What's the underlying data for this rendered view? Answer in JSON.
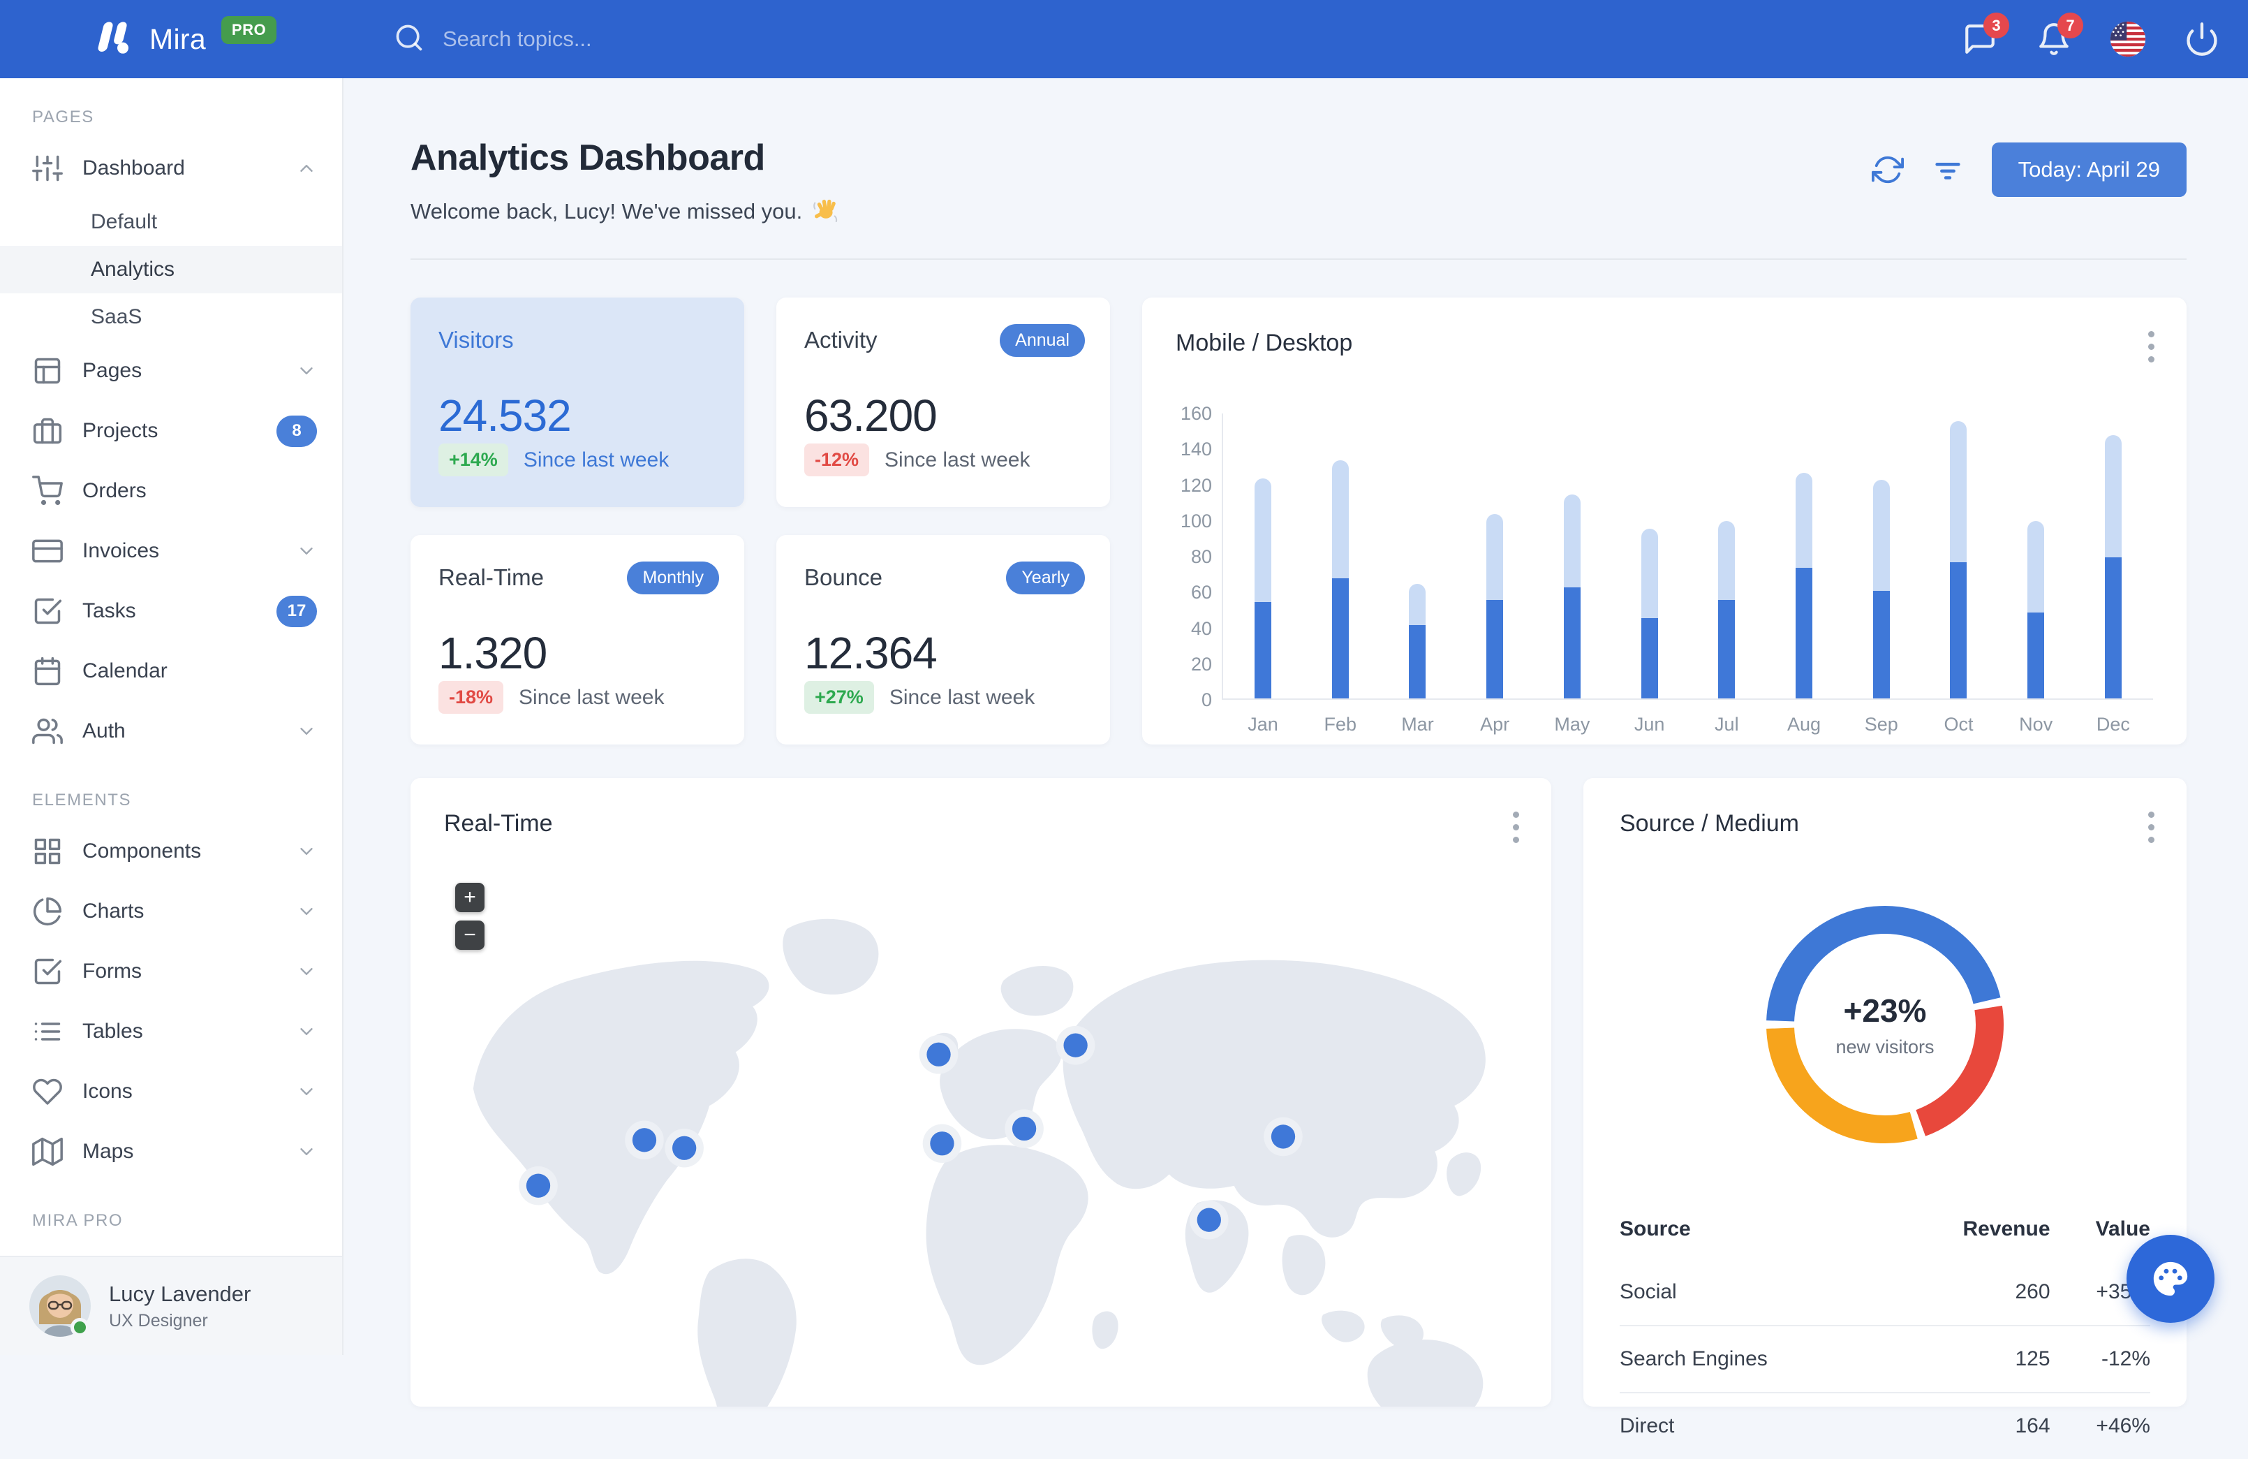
{
  "navbar": {
    "brand": "Mira",
    "brand_badge": "PRO",
    "search_placeholder": "Search topics...",
    "messages_badge": "3",
    "notifications_badge": "7"
  },
  "sidebar": {
    "sections": [
      {
        "label": "PAGES",
        "items": [
          {
            "icon": "sliders",
            "label": "Dashboard",
            "chevron": "up",
            "children": [
              {
                "label": "Default",
                "selected": false
              },
              {
                "label": "Analytics",
                "selected": true
              },
              {
                "label": "SaaS",
                "selected": false
              }
            ]
          },
          {
            "icon": "layout",
            "label": "Pages",
            "chevron": "down"
          },
          {
            "icon": "briefcase",
            "label": "Projects",
            "badge": "8"
          },
          {
            "icon": "shopping-cart",
            "label": "Orders"
          },
          {
            "icon": "credit-card",
            "label": "Invoices",
            "chevron": "down"
          },
          {
            "icon": "check-square",
            "label": "Tasks",
            "badge": "17"
          },
          {
            "icon": "calendar",
            "label": "Calendar"
          },
          {
            "icon": "users",
            "label": "Auth",
            "chevron": "down"
          }
        ]
      },
      {
        "label": "ELEMENTS",
        "items": [
          {
            "icon": "grid",
            "label": "Components",
            "chevron": "down"
          },
          {
            "icon": "pie-chart",
            "label": "Charts",
            "chevron": "down"
          },
          {
            "icon": "check-square",
            "label": "Forms",
            "chevron": "down"
          },
          {
            "icon": "list",
            "label": "Tables",
            "chevron": "down"
          },
          {
            "icon": "heart",
            "label": "Icons",
            "chevron": "down"
          },
          {
            "icon": "map",
            "label": "Maps",
            "chevron": "down"
          }
        ]
      },
      {
        "label": "MIRA PRO",
        "items": []
      }
    ],
    "user": {
      "name": "Lucy Lavender",
      "role": "UX Designer"
    }
  },
  "header": {
    "title": "Analytics Dashboard",
    "subtitle": "Welcome back, Lucy! We've missed you.",
    "subtitle_emoji": "👋",
    "date_button": "Today: April 29"
  },
  "stats": [
    {
      "title": "Visitors",
      "value": "24.532",
      "delta": "+14%",
      "delta_kind": "up",
      "caption": "Since last week",
      "variant": "primary"
    },
    {
      "title": "Activity",
      "value": "63.200",
      "delta": "-12%",
      "delta_kind": "down",
      "caption": "Since last week",
      "badge": "Annual"
    },
    {
      "title": "Real-Time",
      "value": "1.320",
      "delta": "-18%",
      "delta_kind": "down",
      "caption": "Since last week",
      "badge": "Monthly"
    },
    {
      "title": "Bounce",
      "value": "12.364",
      "delta": "+27%",
      "delta_kind": "up",
      "caption": "Since last week",
      "badge": "Yearly"
    }
  ],
  "chart_data": [
    {
      "type": "bar",
      "title": "Mobile / Desktop",
      "stacked": true,
      "categories": [
        "Jan",
        "Feb",
        "Mar",
        "Apr",
        "May",
        "Jun",
        "Jul",
        "Aug",
        "Sep",
        "Oct",
        "Nov",
        "Dec"
      ],
      "series": [
        {
          "name": "Mobile",
          "color": "#3F78D8",
          "values": [
            54,
            67,
            41,
            55,
            62,
            45,
            55,
            73,
            60,
            76,
            48,
            79
          ]
        },
        {
          "name": "Desktop",
          "color": "#C9DBF5",
          "values": [
            69,
            66,
            23,
            48,
            52,
            50,
            44,
            53,
            62,
            79,
            51,
            68
          ]
        }
      ],
      "totals": [
        123,
        133,
        64,
        103,
        114,
        95,
        99,
        126,
        122,
        155,
        99,
        147
      ],
      "xlabel": "",
      "ylabel": "",
      "ylim": [
        0,
        160
      ],
      "ytick_step": 20,
      "grid": false,
      "legend": "none"
    },
    {
      "type": "pie",
      "title": "Source / Medium",
      "donut": true,
      "center_value": "+23%",
      "center_label": "new visitors",
      "segments": [
        {
          "label": "Social",
          "value": 260,
          "color": "#3E78D6"
        },
        {
          "label": "Search Engines",
          "value": 125,
          "color": "#E8483C"
        },
        {
          "label": "Direct",
          "value": 164,
          "color": "#F7A41C"
        }
      ]
    }
  ],
  "map_card": {
    "title": "Real-Time",
    "zoom_in": "+",
    "zoom_out": "−"
  },
  "source_card": {
    "title": "Source / Medium",
    "table": {
      "headers": [
        "Source",
        "Revenue",
        "Value"
      ],
      "rows": [
        {
          "source": "Social",
          "revenue": "260",
          "value": "+35%",
          "kind": "up"
        },
        {
          "source": "Search Engines",
          "revenue": "125",
          "value": "-12%",
          "kind": "down"
        },
        {
          "source": "Direct",
          "revenue": "164",
          "value": "+46%",
          "kind": "up"
        }
      ]
    }
  },
  "colors": {
    "navbar": "#2E63CE",
    "primary": "#3E78D6",
    "primary_light": "#C9DBF5",
    "green": "#2DA94F",
    "red": "#E14A44",
    "donut_orange": "#F7A41C",
    "donut_red": "#E8483C",
    "badge_red": "#E5484D",
    "pro_green": "#459C4D"
  }
}
